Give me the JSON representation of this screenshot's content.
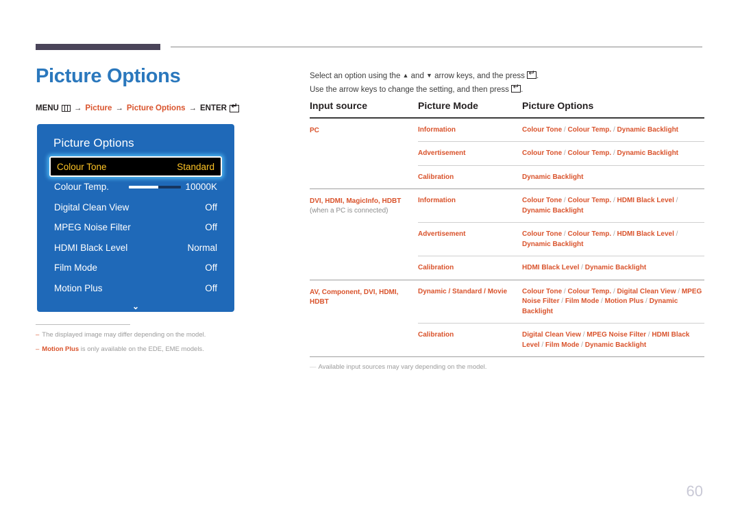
{
  "header": {
    "title": "Picture Options",
    "breadcrumb": {
      "menu_label": "MENU",
      "menu_icon": "menu-grid-icon",
      "arrow": "→",
      "step1": "Picture",
      "step2": "Picture Options",
      "enter_label": "ENTER",
      "enter_icon": "enter-return-icon"
    }
  },
  "osd": {
    "title": "Picture Options",
    "rows": [
      {
        "label": "Colour Tone",
        "value": "Standard",
        "selected": true,
        "type": "option"
      },
      {
        "label": "Colour Temp.",
        "value": "10000K",
        "selected": false,
        "type": "slider",
        "slider_fill_percent": 56
      },
      {
        "label": "Digital Clean View",
        "value": "Off",
        "selected": false,
        "type": "option"
      },
      {
        "label": "MPEG Noise Filter",
        "value": "Off",
        "selected": false,
        "type": "option"
      },
      {
        "label": "HDMI Black Level",
        "value": "Normal",
        "selected": false,
        "type": "option"
      },
      {
        "label": "Film Mode",
        "value": "Off",
        "selected": false,
        "type": "option"
      },
      {
        "label": "Motion Plus",
        "value": "Off",
        "selected": false,
        "type": "option"
      }
    ],
    "scroll_indicator": "⌄",
    "panel_color": "#1f69b8",
    "selected_row_color": "#000000",
    "selected_text_color": "#ffc425"
  },
  "left_notes": [
    {
      "dash": "–",
      "text": "The displayed image may differ depending on the model.",
      "accent": ""
    },
    {
      "dash": "–",
      "accent": "Motion Plus",
      "text": " is only available on the EDE, EME models."
    }
  ],
  "intro": {
    "line1_a": "Select an option using the ",
    "line1_tri_up": "▲",
    "line1_b": " and ",
    "line1_tri_down": "▼",
    "line1_c": " arrow keys, and the press ",
    "line1_d": ".",
    "line2_a": "Use the arrow keys to change the setting, and then press ",
    "line2_b": "."
  },
  "table": {
    "headers": [
      "Input source",
      "Picture Mode",
      "Picture Options"
    ],
    "groups": [
      {
        "source_main": "PC",
        "source_sub": "",
        "rows": [
          {
            "mode": "Information",
            "options": "Colour Tone / Colour Temp. / Dynamic Backlight"
          },
          {
            "mode": "Advertisement",
            "options": "Colour Tone / Colour Temp. / Dynamic Backlight"
          },
          {
            "mode": "Calibration",
            "options": "Dynamic Backlight"
          }
        ]
      },
      {
        "source_main": "DVI, HDMI, MagicInfo, HDBT",
        "source_sub": "(when a PC is connected)",
        "rows": [
          {
            "mode": "Information",
            "options": "Colour Tone / Colour Temp. / HDMI Black Level / Dynamic Backlight"
          },
          {
            "mode": "Advertisement",
            "options": "Colour Tone / Colour Temp. / HDMI Black Level / Dynamic Backlight"
          },
          {
            "mode": "Calibration",
            "options": "HDMI Black Level / Dynamic Backlight"
          }
        ]
      },
      {
        "source_main": "AV, Component, DVI, HDMI, HDBT",
        "source_sub": "",
        "rows": [
          {
            "mode": "Dynamic / Standard / Movie",
            "options": "Colour Tone / Colour Temp. / Digital Clean View / MPEG Noise Filter / Film Mode / Motion Plus / Dynamic Backlight"
          },
          {
            "mode": "Calibration",
            "options": "Digital Clean View / MPEG Noise Filter / HDMI Black Level / Film Mode / Dynamic Backlight"
          }
        ]
      }
    ],
    "footnote": {
      "dash": "—",
      "text": "Available input sources may vary depending on the model."
    }
  },
  "page_number": "60"
}
